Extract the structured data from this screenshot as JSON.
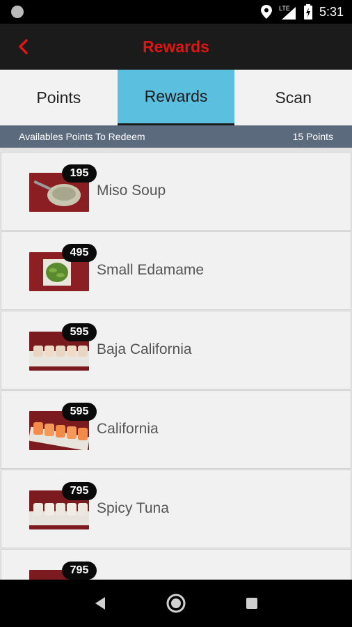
{
  "status": {
    "time": "5:31",
    "network": "LTE"
  },
  "app_bar": {
    "title": "Rewards"
  },
  "tabs": [
    {
      "label": "Points",
      "active": false
    },
    {
      "label": "Rewards",
      "active": true
    },
    {
      "label": "Scan",
      "active": false
    }
  ],
  "points_strip": {
    "label": "Availables Points To Redeem",
    "value": "15 Points"
  },
  "rewards": [
    {
      "points": "195",
      "name": "Miso Soup",
      "image": "miso-soup-image"
    },
    {
      "points": "495",
      "name": "Small Edamame",
      "image": "edamame-image"
    },
    {
      "points": "595",
      "name": "Baja California",
      "image": "baja-roll-image"
    },
    {
      "points": "595",
      "name": "California",
      "image": "california-roll-image"
    },
    {
      "points": "795",
      "name": "Spicy Tuna",
      "image": "spicy-tuna-image"
    },
    {
      "points": "795",
      "name": "",
      "image": "roll-image"
    }
  ],
  "colors": {
    "accent_red": "#e01616",
    "tab_active": "#5bbfe0",
    "strip": "#5c6a7e",
    "app_bar": "#1b1b1b"
  }
}
